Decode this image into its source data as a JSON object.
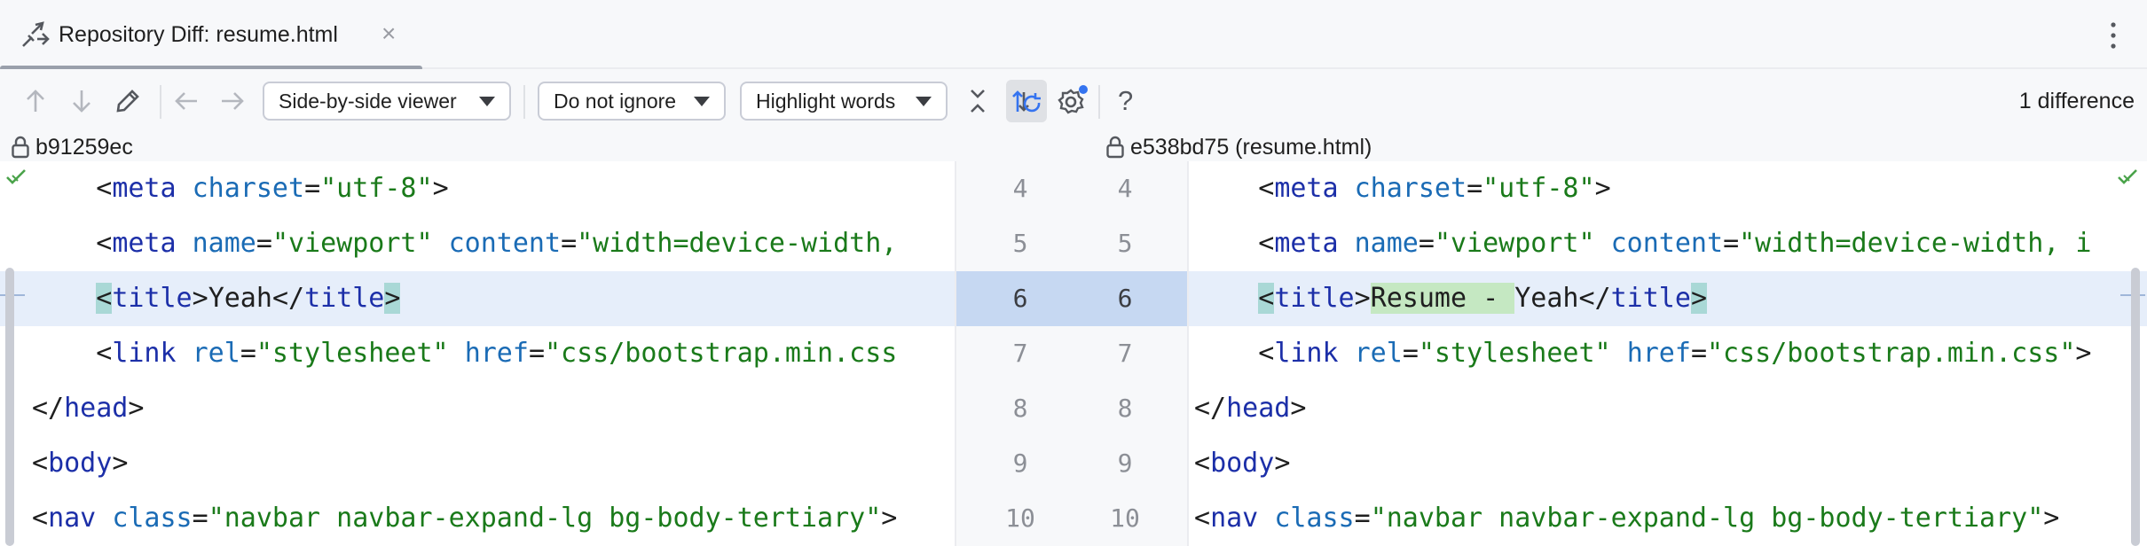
{
  "tab": {
    "title": "Repository Diff: resume.html",
    "close": "×",
    "icon": "diff-icon"
  },
  "toolbar": {
    "viewer": "Side-by-side viewer",
    "ignore": "Do not ignore",
    "highlight": "Highlight words",
    "help": "?",
    "diff_count": "1 difference",
    "icons": [
      "arrow-up-icon",
      "arrow-down-icon",
      "edit-icon",
      "arrow-left-icon",
      "arrow-right-icon",
      "collapse-icon",
      "sync-scroll-icon",
      "settings-icon",
      "help-icon"
    ]
  },
  "left": {
    "revision": "b91259ec",
    "lines": [
      {
        "num": "4"
      },
      {
        "num": "5"
      },
      {
        "num": "6"
      },
      {
        "num": "7"
      },
      {
        "num": "8"
      },
      {
        "num": "9"
      },
      {
        "num": "10"
      }
    ]
  },
  "right": {
    "revision": "e538bd75 (resume.html)",
    "lines": [
      {
        "num": "4"
      },
      {
        "num": "5"
      },
      {
        "num": "6"
      },
      {
        "num": "7"
      },
      {
        "num": "8"
      },
      {
        "num": "9"
      },
      {
        "num": "10"
      }
    ]
  },
  "code": {
    "lt": "<",
    "gt": ">",
    "ltslash": "</",
    "meta": "meta",
    "charset": "charset",
    "eq": "=",
    "utf8": "\"utf-8\"",
    "name": "name",
    "viewport": "\"viewport\"",
    "content": "content",
    "content_val_left": "\"width=device-width,",
    "content_val_right": "\"width=device-width, i",
    "title": "title",
    "left_title_text": "Yeah",
    "right_title_ins": "Resume - ",
    "right_title_text": "Yeah",
    "link": "link",
    "rel": "rel",
    "stylesheet": "\"stylesheet\"",
    "href": "href",
    "href_val_left": "\"css/bootstrap.min.css",
    "href_val_right": "\"css/bootstrap.min.css\"",
    "head": "head",
    "body": "body",
    "nav": "nav",
    "class": "class",
    "nav_class": "\"navbar navbar-expand-lg bg-body-tertiary\""
  },
  "colors": {
    "tag": "#1c2fa8",
    "attr": "#1a6bb5",
    "string": "#1a7a1a",
    "changed_line": "#e6eefa",
    "inserted_word": "#c5e8c2",
    "bracket_highlight": "#a9d8d6"
  }
}
